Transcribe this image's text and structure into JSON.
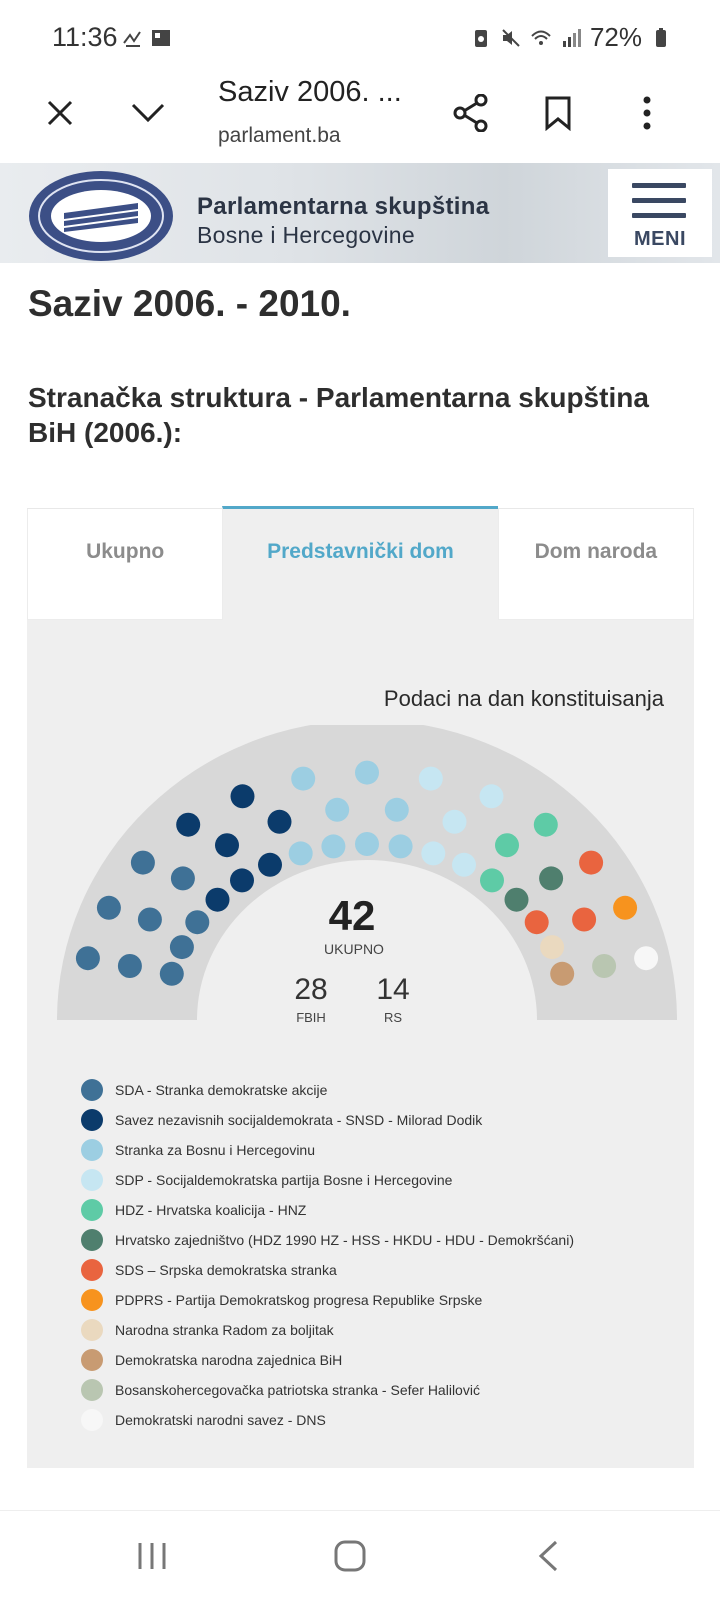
{
  "status_bar": {
    "time": "11:36",
    "battery": "72%"
  },
  "browser": {
    "page_title": "Saziv 2006. ...",
    "url": "parlament.ba",
    "icons": [
      "close-icon",
      "chevron-down-icon",
      "share-icon",
      "bookmark-icon",
      "more-vert-icon"
    ]
  },
  "site": {
    "name_line1": "Parlamentarna skupština",
    "name_line2": "Bosne i Hercegovine",
    "menu_label": "MENI"
  },
  "page": {
    "title": "Saziv 2006. - 2010.",
    "section_title": "Stranačka struktura - Parlamentarna skupština BiH (2006.):"
  },
  "tabs": [
    {
      "label": "Ukupno",
      "active": false
    },
    {
      "label": "Predstavnički dom",
      "active": true
    },
    {
      "label": "Dom naroda",
      "active": false
    }
  ],
  "panel": {
    "note": "Podaci na dan konstituisanja",
    "total": "42",
    "total_label": "UKUPNO",
    "fbih": "28",
    "fbih_label": "FBIH",
    "rs": "14",
    "rs_label": "RS"
  },
  "parties": [
    {
      "name": "SDA - Stranka demokratske akcije",
      "color": "#3f7196",
      "seats": 9
    },
    {
      "name": "Savez nezavisnih socijaldemokrata - SNSD - Milorad Dodik",
      "color": "#0b3b6b",
      "seats": 7
    },
    {
      "name": "Stranka za Bosnu i Hercegovinu",
      "color": "#9ccee2",
      "seats": 8
    },
    {
      "name": "SDP - Socijaldemokratska partija Bosne i Hercegovine",
      "color": "#c6e6f2",
      "seats": 5
    },
    {
      "name": "HDZ - Hrvatska koalicija - HNZ",
      "color": "#5ecba6",
      "seats": 3
    },
    {
      "name": "Hrvatsko zajedništvo (HDZ 1990 HZ - HSS - HKDU - HDU - Demokršćani)",
      "color": "#4f7f6e",
      "seats": 2
    },
    {
      "name": "SDS – Srpska demokratska stranka",
      "color": "#e9643f",
      "seats": 3
    },
    {
      "name": "PDPRS - Partija Demokratskog progresa Republike Srpske",
      "color": "#f7931e",
      "seats": 1
    },
    {
      "name": "Narodna stranka Radom za boljitak",
      "color": "#ead9bf",
      "seats": 1
    },
    {
      "name": "Demokratska narodna zajednica BiH",
      "color": "#c89b72",
      "seats": 1
    },
    {
      "name": "Bosanskohercegovačka patriotska stranka - Sefer Halilović",
      "color": "#b9c6b1",
      "seats": 1
    },
    {
      "name": "Demokratski narodni savez - DNS",
      "color": "#f7f7f7",
      "seats": 1
    }
  ],
  "nav": {
    "icons": [
      "recent-apps-icon",
      "home-icon",
      "back-icon"
    ]
  }
}
